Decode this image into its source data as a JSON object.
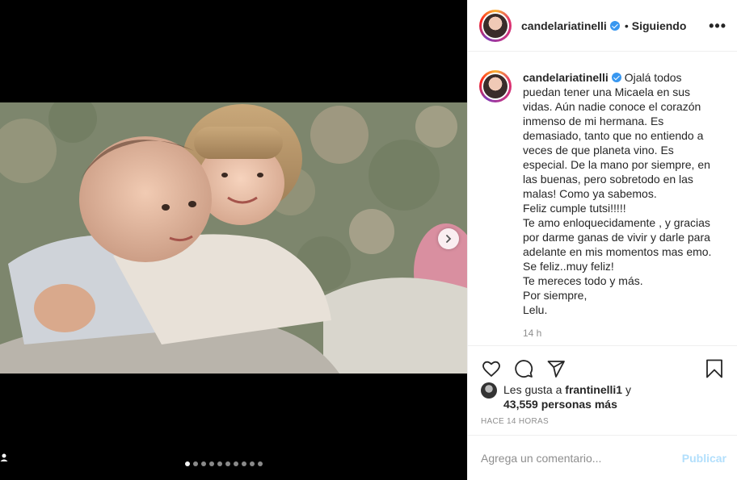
{
  "post": {
    "username": "candelariatinelli",
    "follow_status": "Siguiendo",
    "separator": "•",
    "more_icon": "more-horizontal-icon",
    "carousel": {
      "slides_count": 10,
      "active_index": 0
    }
  },
  "caption": {
    "username": "candelariatinelli",
    "text": "Ojalá todos puedan tener una Micaela en sus vidas. Aún nadie conoce el corazón inmenso de mi hermana. Es demasiado, tanto que no entiendo a veces de que planeta vino. Es especial. De la mano por siempre, en las buenas, pero sobretodo en las malas! Como ya sabemos.\nFeliz cumple tutsi!!!!!\nTe amo enloquecidamente , y gracias por darme ganas de vivir y darle para adelante en mis momentos mas emo.\nSe feliz..muy feliz!\nTe mereces todo y más.\nPor siempre,\nLelu.",
    "time_ago": "14 h"
  },
  "likes": {
    "prefix": "Les gusta a ",
    "user": "frantinelli1",
    "connector": " y",
    "count_text": "43,559 personas más"
  },
  "posted_ago": "HACE 14 HORAS",
  "comment": {
    "placeholder": "Agrega un comentario...",
    "publish_label": "Publicar"
  },
  "colors": {
    "verified": "#3897f0",
    "publish_disabled": "#b2dffc",
    "muted": "#8e8e8e"
  }
}
